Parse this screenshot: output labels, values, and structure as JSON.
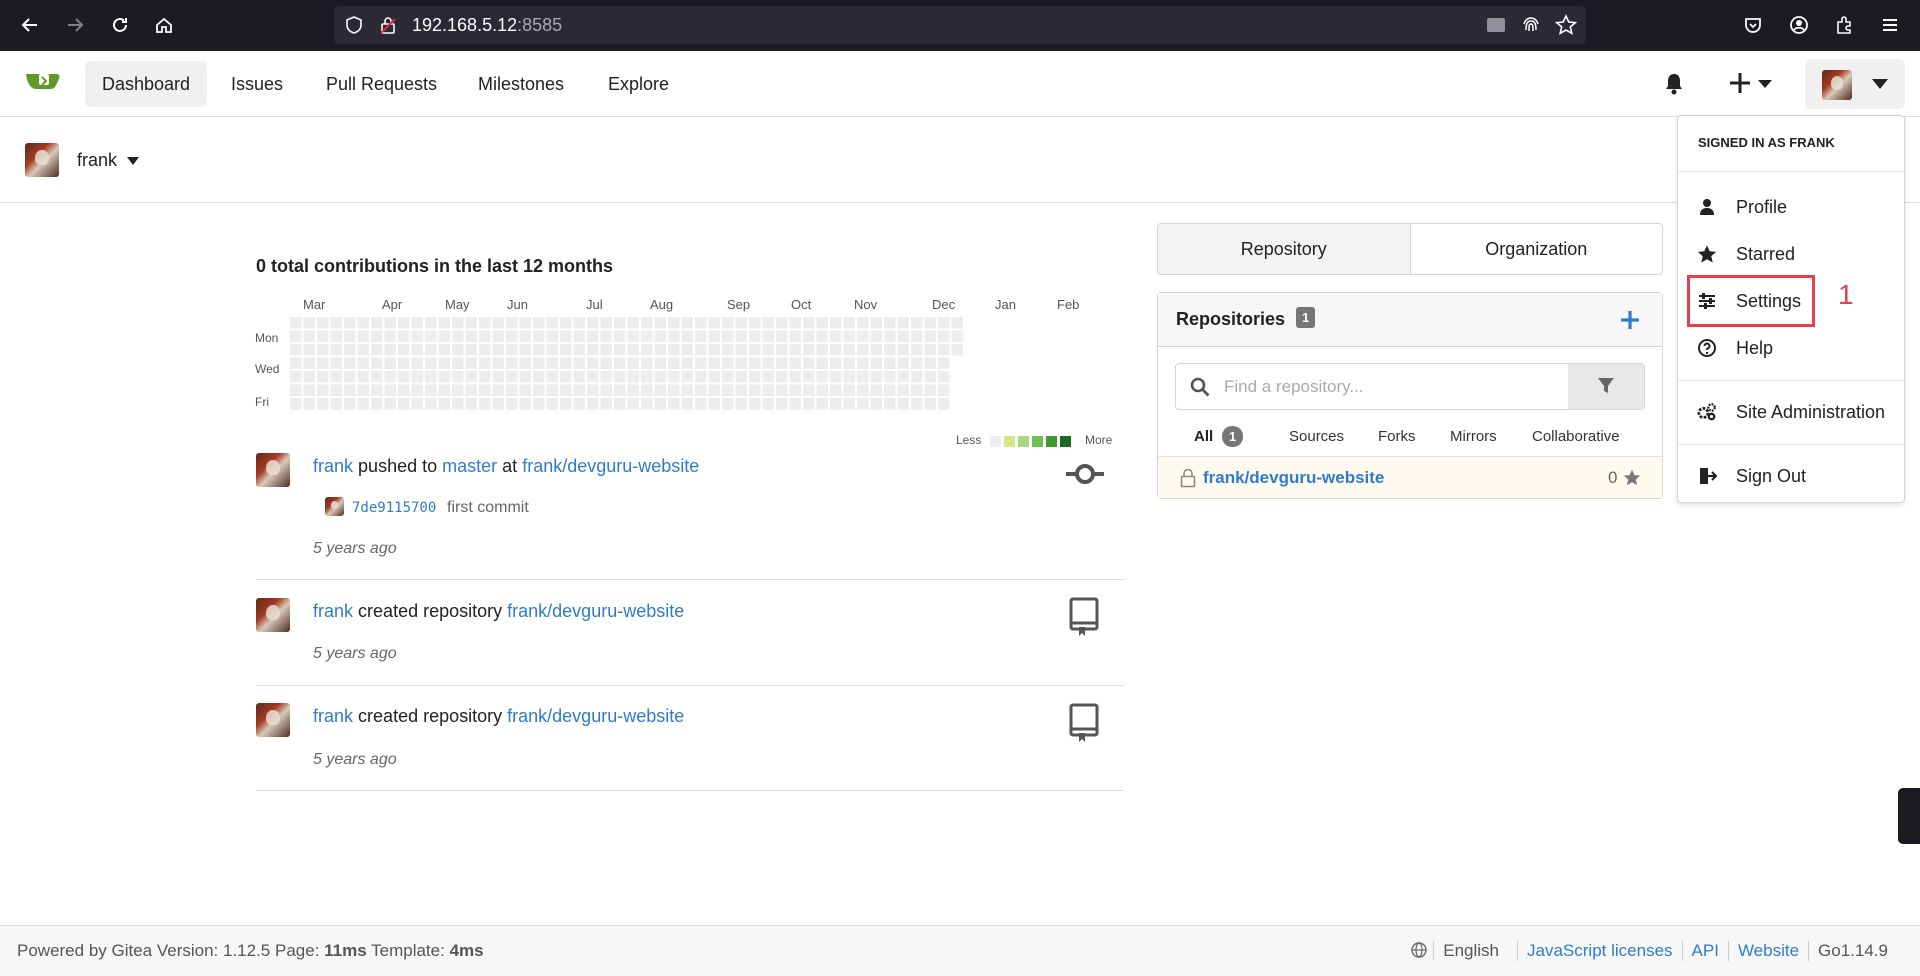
{
  "browser": {
    "url_host": "192.168.5.12",
    "url_port": ":8585"
  },
  "nav": {
    "items": [
      "Dashboard",
      "Issues",
      "Pull Requests",
      "Milestones",
      "Explore"
    ],
    "active": "Dashboard"
  },
  "context": {
    "user": "frank"
  },
  "heatmap": {
    "title": "0 total contributions in the last 12 months",
    "months": [
      "Mar",
      "Apr",
      "May",
      "Jun",
      "Jul",
      "Aug",
      "Sep",
      "Oct",
      "Nov",
      "Dec",
      "Jan",
      "Feb"
    ],
    "days": [
      "Mon",
      "Wed",
      "Fri"
    ],
    "legend_less": "Less",
    "legend_more": "More",
    "total": 0
  },
  "feed": [
    {
      "user": "frank",
      "action": "pushed to",
      "branch": "master",
      "at": "at",
      "repo": "frank/devguru-website",
      "commit_sha": "7de9115700",
      "commit_msg": "first commit",
      "time": "5 years ago"
    },
    {
      "user": "frank",
      "action": "created repository",
      "repo": "frank/devguru-website",
      "time": "5 years ago"
    },
    {
      "user": "frank",
      "action": "created repository",
      "repo": "frank/devguru-website",
      "time": "5 years ago"
    }
  ],
  "panel": {
    "tabs": [
      "Repository",
      "Organization"
    ],
    "repos_title": "Repositories",
    "repos_count": "1",
    "search_placeholder": "Find a repository...",
    "subtabs": [
      "All",
      "Sources",
      "Forks",
      "Mirrors",
      "Collaborative"
    ],
    "all_count": "1",
    "repo_name": "frank/devguru-website",
    "repo_stars": "0"
  },
  "dropdown": {
    "header": "SIGNED IN AS FRANK",
    "items": [
      "Profile",
      "Starred",
      "Settings",
      "Help",
      "Site Administration",
      "Sign Out"
    ],
    "callout": "1"
  },
  "footer": {
    "powered": "Powered by Gitea Version: 1.12.5 Page:",
    "page_time": "11ms",
    "template_label": "Template:",
    "template_time": "4ms",
    "language": "English",
    "links": [
      "JavaScript licenses",
      "API",
      "Website"
    ],
    "go_version": "Go1.14.9"
  },
  "colors": {
    "accent": "#2f7bcc",
    "highlight": "#e5414a",
    "logo_green": "#609926"
  }
}
